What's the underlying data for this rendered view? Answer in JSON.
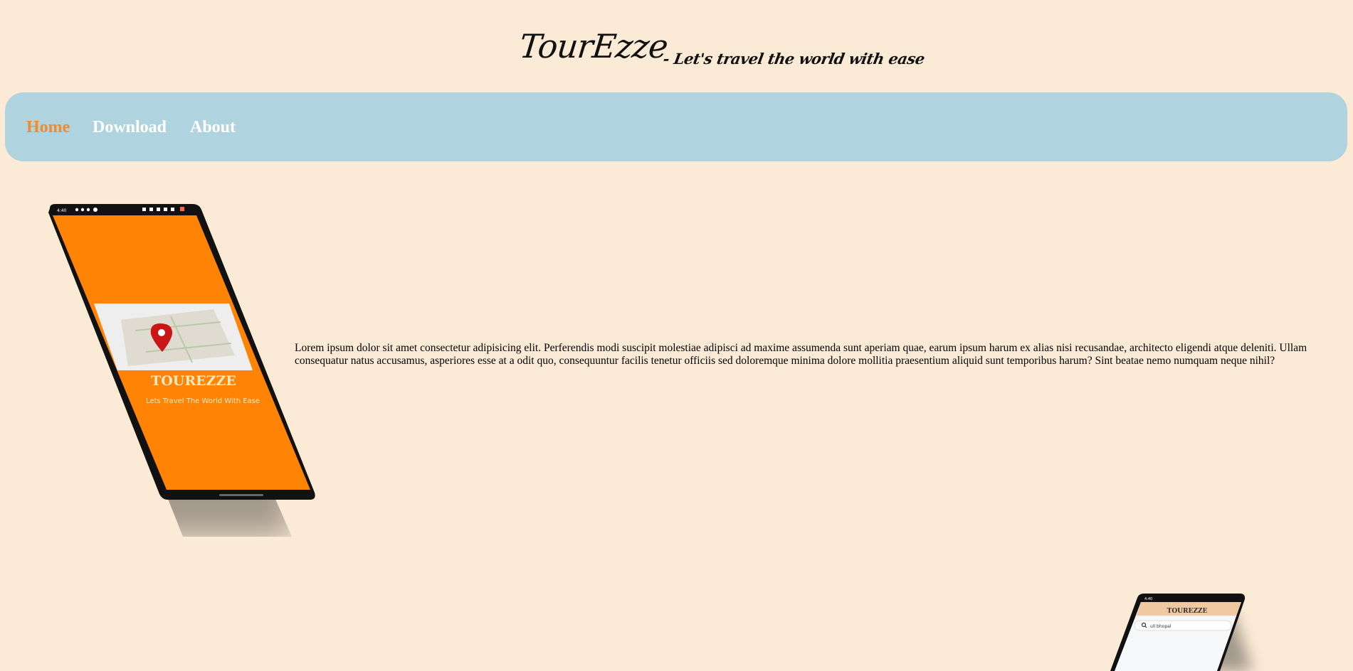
{
  "header": {
    "title": "TourEzze",
    "tagline": "- Let's travel the world with ease"
  },
  "nav": {
    "items": [
      {
        "label": "Home",
        "active": true
      },
      {
        "label": "Download",
        "active": false
      },
      {
        "label": "About",
        "active": false
      }
    ]
  },
  "hero": {
    "paragraph": "Lorem ipsum dolor sit amet consectetur adipisicing elit. Perferendis modi suscipit molestiae adipisci ad maxime assumenda sunt aperiam quae, earum ipsum harum ex alias nisi recusandae, architecto eligendi atque deleniti. Ullam consequatur natus accusamus, asperiores esse at a odit quo, consequuntur facilis tenetur officiis sed doloremque minima dolore mollitia praesentium aliquid sunt temporibus harum? Sint beatae nemo numquam neque nihil?"
  },
  "phone1": {
    "status_time": "4:40",
    "app_name": "TOUREZZE",
    "app_tagline": "Lets Travel The World With Ease"
  },
  "phone2": {
    "status_time": "4:40",
    "app_name": "TOUREZZE",
    "search_value": "ull bhopal"
  },
  "colors": {
    "page_bg": "#fbebd6",
    "nav_bg": "#afd4df",
    "nav_active": "#f28b2e",
    "phone_screen": "#ff8406"
  }
}
